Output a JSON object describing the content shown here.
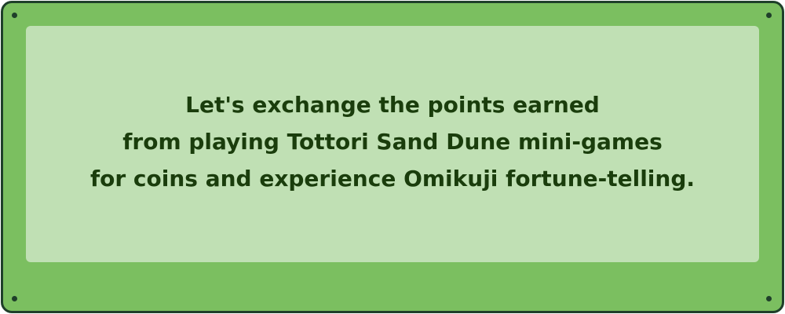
{
  "board": {
    "message_lines": [
      "Let's exchange the points earned",
      "from playing Tottori Sand Dune mini-games",
      "for coins and experience Omikuji fortune-telling."
    ]
  },
  "colors": {
    "board_frame": "#7bbf60",
    "board_border": "#1f3f2a",
    "inner_panel": "#c0e0b4",
    "text": "#1a3d0c"
  }
}
